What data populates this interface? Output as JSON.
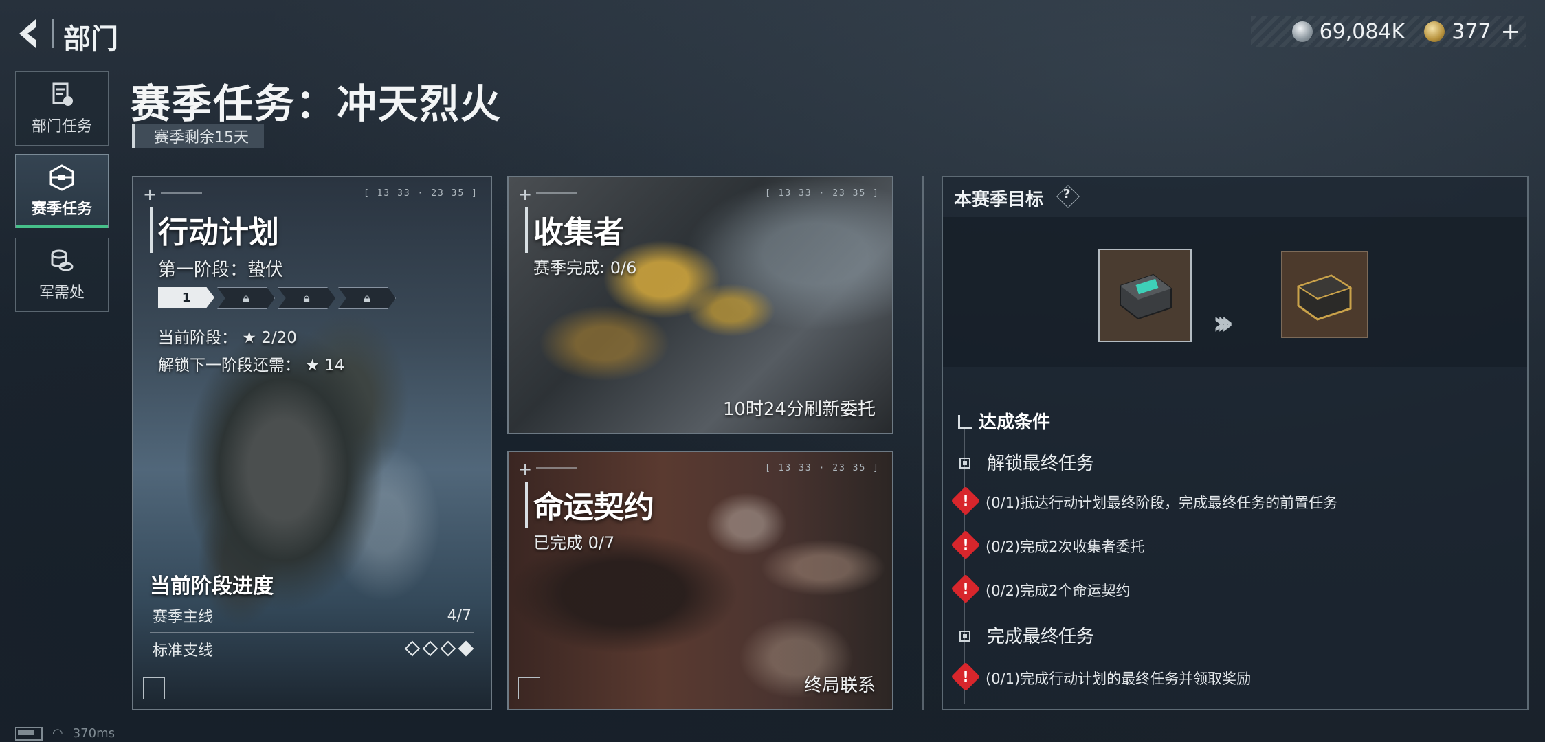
{
  "header": {
    "title": "部门"
  },
  "currency": {
    "silver": "69,084K",
    "gold": "377",
    "plus": "+"
  },
  "sidebar": {
    "items": [
      {
        "label": "部门任务",
        "icon": "document-badge-icon"
      },
      {
        "label": "赛季任务",
        "icon": "crate-icon",
        "active": true
      },
      {
        "label": "军需处",
        "icon": "coin-stack-icon"
      }
    ]
  },
  "season": {
    "title": "赛季任务：冲天烈火",
    "remaining": "赛季剩余15天"
  },
  "plan_card": {
    "title": "行动计划",
    "stage": "第一阶段：蛰伏",
    "stage_segments": [
      "1",
      "",
      "",
      ""
    ],
    "current_stage_label": "当前阶段：",
    "current_stage_value": "★  2/20",
    "unlock_label": "解锁下一阶段还需：",
    "unlock_value": "★  14",
    "progress_title": "当前阶段进度",
    "rows": [
      {
        "label": "赛季主线",
        "value": "4/7"
      },
      {
        "label": "标准支线",
        "diamonds_total": 4,
        "diamonds_done": 1
      }
    ],
    "ticker": "[ 13 33 · 23 35 ]"
  },
  "collector_card": {
    "title": "收集者",
    "sub": "赛季完成: 0/6",
    "footer": "10时24分刷新委托",
    "ticker": "[ 13 33 · 23 35 ]"
  },
  "fate_card": {
    "title": "命运契约",
    "sub": "已完成 0/7",
    "footer": "终局联系",
    "ticker": "[ 13 33 · 23 35 ]"
  },
  "goal": {
    "title": "本赛季目标",
    "help": "?",
    "conditions_title": "达成条件",
    "groups": [
      {
        "title": "解锁最终任务",
        "requirements": [
          "(0/1)抵达行动计划最终阶段，完成最终任务的前置任务",
          "(0/2)完成2次收集者委托",
          "(0/2)完成2个命运契约"
        ]
      },
      {
        "title": "完成最终任务",
        "requirements": [
          "(0/1)完成行动计划的最终任务并领取奖励"
        ]
      }
    ]
  },
  "status_bar": {
    "ping": "370ms"
  },
  "colors": {
    "accent_green": "#46c08a",
    "warning_red": "#d8262c",
    "panel_border": "#6d7983"
  }
}
